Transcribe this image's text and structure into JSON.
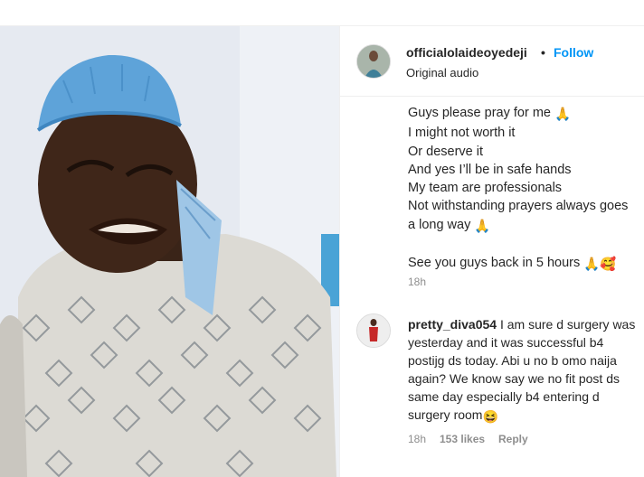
{
  "post": {
    "username": "officialolaideoyedeji",
    "separator": "•",
    "follow_label": "Follow",
    "audio_label": "Original audio",
    "caption_lines": [
      "Guys please pray for me",
      "I might not worth it",
      "Or deserve it",
      "And yes I’ll be in safe hands",
      "My team are professionals",
      "Not withstanding prayers always goes",
      "a long way",
      "",
      "See you guys back in 5 hours"
    ],
    "caption_time": "18h"
  },
  "comment": {
    "username": "pretty_diva054",
    "text": "I am sure d surgery was yesterday and it was successful b4 postijg ds today. Abi u no b omo naija again? We know say we no fit post ds same day especially b4 entering d surgery room",
    "time": "18h",
    "likes": "153 likes",
    "reply_label": "Reply"
  },
  "icons": {
    "pray": "folded-hands-emoji",
    "love": "smiling-face-with-hearts-emoji",
    "laugh": "grinning-squinting-face-emoji"
  },
  "colors": {
    "link": "#0095f6",
    "secondary_text": "#8e8e8e",
    "primary_text": "#262626"
  }
}
